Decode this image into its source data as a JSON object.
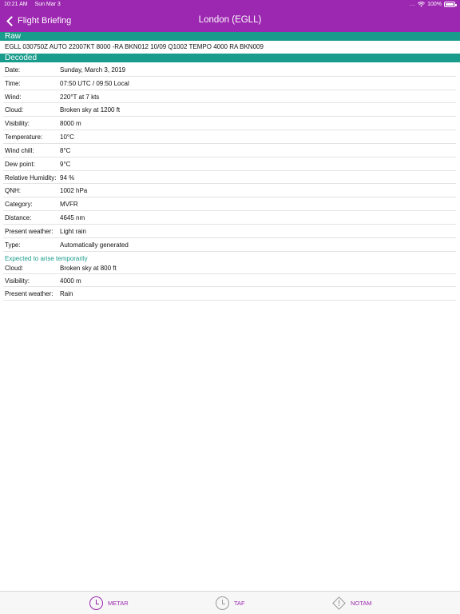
{
  "status_bar": {
    "time": "10:21 AM",
    "date": "Sun Mar 3",
    "signal": "....",
    "battery": "100%"
  },
  "nav": {
    "back_label": "Flight Briefing",
    "title": "London (EGLL)"
  },
  "raw": {
    "header": "Raw",
    "text": "EGLL 030750Z AUTO 22007KT 8000 -RA BKN012 10/09 Q1002 TEMPO 4000 RA BKN009"
  },
  "decoded": {
    "header": "Decoded",
    "rows": [
      {
        "label": "Date:",
        "value": "Sunday, March 3, 2019"
      },
      {
        "label": "Time:",
        "value": "07:50 UTC / 09:50 Local"
      },
      {
        "label": "Wind:",
        "value": "220°T at 7 kts"
      },
      {
        "label": "Cloud:",
        "value": "Broken sky at 1200 ft"
      },
      {
        "label": "Visibility:",
        "value": "8000 m"
      },
      {
        "label": "Temperature:",
        "value": "10°C"
      },
      {
        "label": "Wind chill:",
        "value": "8°C"
      },
      {
        "label": "Dew point:",
        "value": "9°C"
      },
      {
        "label": "Relative Humidity:",
        "value": "94 %"
      },
      {
        "label": "QNH:",
        "value": "1002 hPa"
      },
      {
        "label": "Category:",
        "value": "MVFR"
      },
      {
        "label": "Distance:",
        "value": "4645 nm"
      },
      {
        "label": "Present weather:",
        "value": "Light rain"
      },
      {
        "label": "Type:",
        "value": "Automatically generated"
      }
    ],
    "temporary_heading": "Expected to arise temporarily",
    "temporary_rows": [
      {
        "label": "Cloud:",
        "value": "Broken sky at 800 ft"
      },
      {
        "label": "Visibility:",
        "value": "4000 m"
      },
      {
        "label": "Present weather:",
        "value": "Rain"
      }
    ]
  },
  "tabs": {
    "metar": "METAR",
    "taf": "TAF",
    "notam": "NOTAM"
  },
  "colors": {
    "accent": "#9c27b0",
    "section": "#1a9c8c"
  }
}
